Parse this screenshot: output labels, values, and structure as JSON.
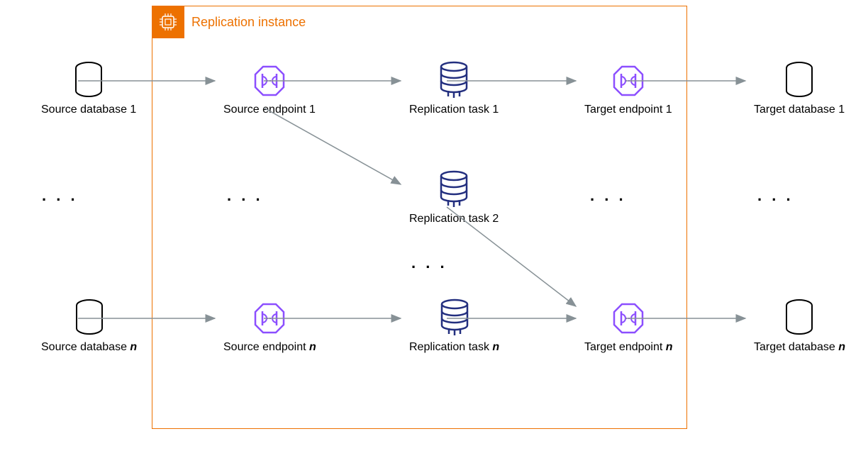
{
  "container": {
    "title": "Replication instance"
  },
  "nodes": {
    "source_db_1": "Source database 1",
    "source_db_n_prefix": "Source database ",
    "source_db_n_suffix": "n",
    "source_ep_1": "Source endpoint 1",
    "source_ep_n_prefix": "Source endpoint ",
    "source_ep_n_suffix": "n",
    "rep_task_1": "Replication task 1",
    "rep_task_2": "Replication task 2",
    "rep_task_n_prefix": "Replication task ",
    "rep_task_n_suffix": "n",
    "target_ep_1": "Target endpoint 1",
    "target_ep_n_prefix": "Target endpoint ",
    "target_ep_n_suffix": "n",
    "target_db_1": "Target database 1",
    "target_db_n_prefix": "Target database ",
    "target_db_n_suffix": "n"
  },
  "ellipsis": ". . ."
}
